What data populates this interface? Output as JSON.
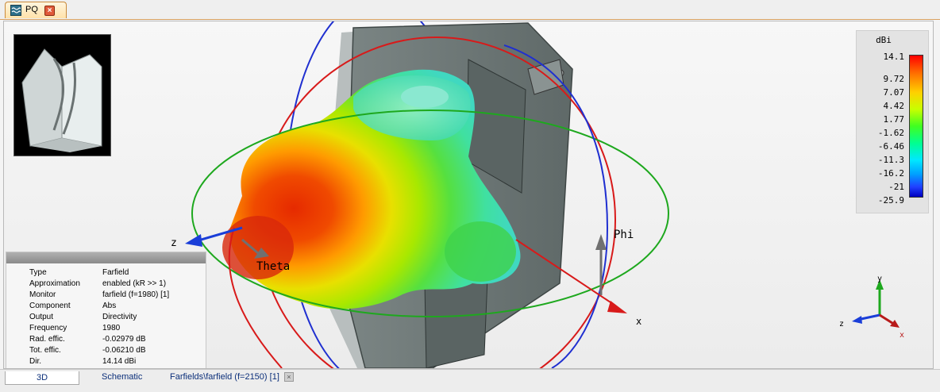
{
  "tab": {
    "label": "PQ",
    "icon": "waveform-icon"
  },
  "viewport": {
    "axis_labels": {
      "z": "z",
      "theta": "Theta",
      "phi": "Phi",
      "x": "x"
    },
    "mini_axes": {
      "y": "y",
      "z": "z",
      "x": "x"
    }
  },
  "legend": {
    "unit": "dBi",
    "values": [
      "14.1",
      "9.72",
      "7.07",
      "4.42",
      "1.77",
      "-1.62",
      "-6.46",
      "-11.3",
      "-16.2",
      "-21",
      "-25.9"
    ],
    "colors": {
      "max": "#ff0000",
      "mid": "#40ff20",
      "min": "#0000c0"
    }
  },
  "info": {
    "rows": [
      {
        "key": "Type",
        "value": "Farfield"
      },
      {
        "key": "Approximation",
        "value": "enabled (kR >> 1)"
      },
      {
        "key": "Monitor",
        "value": "farfield (f=1980) [1]"
      },
      {
        "key": "Component",
        "value": "Abs"
      },
      {
        "key": "Output",
        "value": "Directivity"
      },
      {
        "key": "Frequency",
        "value": "1980"
      },
      {
        "key": "Rad. effic.",
        "value": "-0.02979 dB"
      },
      {
        "key": "Tot. effic.",
        "value": "-0.06210 dB"
      },
      {
        "key": "Dir.",
        "value": "14.14 dBi"
      }
    ]
  },
  "bottom_tabs": {
    "tab_3d": "3D",
    "tab_schematic": "Schematic",
    "tab_farfield": "Farfields\\farfield (f=2150) [1]"
  }
}
